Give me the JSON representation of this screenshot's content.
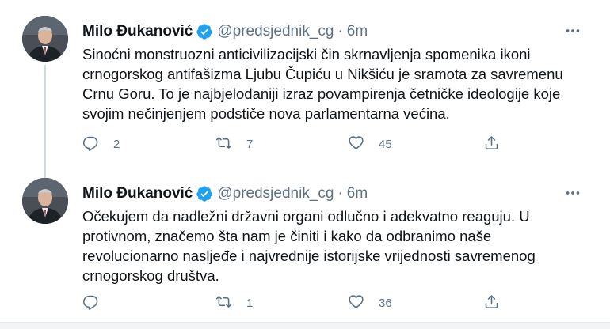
{
  "tweets": [
    {
      "author": "Milo Đukanović",
      "handle": "@predsjednik_cg",
      "separator": "·",
      "time": "6m",
      "text": "Sinoćni monstruozni anticivilizacijski čin skrnavljenja spomenika ikoni\ncrnogorskog antifašizma Ljubu Čupiću u Nikšiću je sramota za savremenu\nCrnu Goru. To je najbjelodaniji izraz povampirenja četničke ideologije koje\nsvojim nečinjenjem podstiče nova parlamentarna većina.",
      "replies": "2",
      "retweets": "7",
      "likes": "45"
    },
    {
      "author": "Milo Đukanović",
      "handle": "@predsjednik_cg",
      "separator": "·",
      "time": "6m",
      "text": "Očekujem da nadležni državni organi odlučno i adekvatno reaguju. U\nprotivnom, značemo šta nam je činiti i kako da odbranimo naše\nrevolucionarno nasljeđe i najvrednije istorijske vrijednosti savremenog\ncrnogorskog društva.",
      "replies": "",
      "retweets": "1",
      "likes": "36"
    }
  ],
  "icons": {
    "verified": "verified-badge-icon",
    "more": "more-dots-icon",
    "reply": "reply-icon",
    "retweet": "retweet-icon",
    "like": "heart-icon",
    "share": "share-icon"
  },
  "colors": {
    "verified": "#1da1f2",
    "secondary_text": "#5b7083",
    "thread_line": "#cfd9de"
  }
}
